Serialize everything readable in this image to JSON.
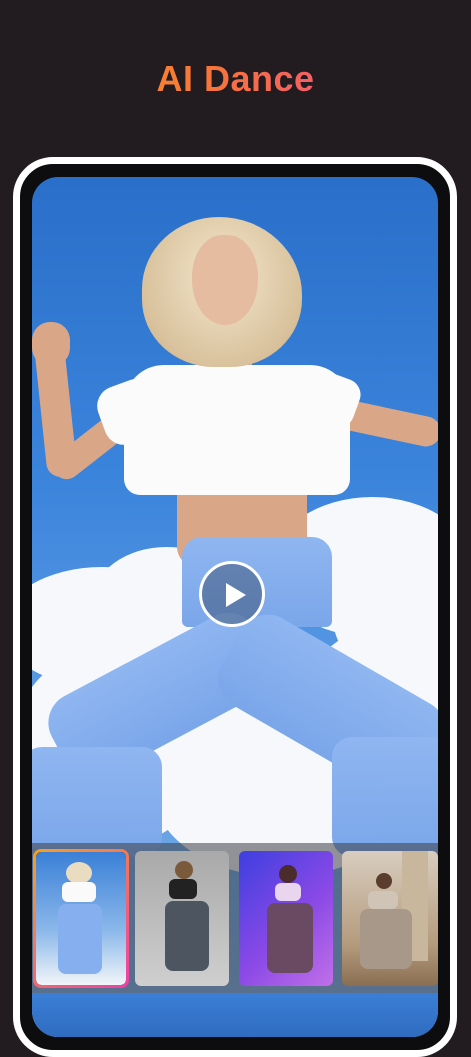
{
  "header": {
    "title": "AI Dance"
  },
  "colors": {
    "background": "#221c21",
    "title_gradient": [
      "#f7a21b",
      "#f7743a",
      "#ee3fa8"
    ],
    "frame": "#ffffff",
    "selected_border": [
      "#f7a21b",
      "#ee3fa8"
    ]
  },
  "preview": {
    "play_icon": "play-icon"
  },
  "thumbnails": [
    {
      "name": "dance-style-blue-sky",
      "selected": true
    },
    {
      "name": "dance-style-studio-gray",
      "selected": false
    },
    {
      "name": "dance-style-purple-light",
      "selected": false
    },
    {
      "name": "dance-style-columns",
      "selected": false
    }
  ]
}
